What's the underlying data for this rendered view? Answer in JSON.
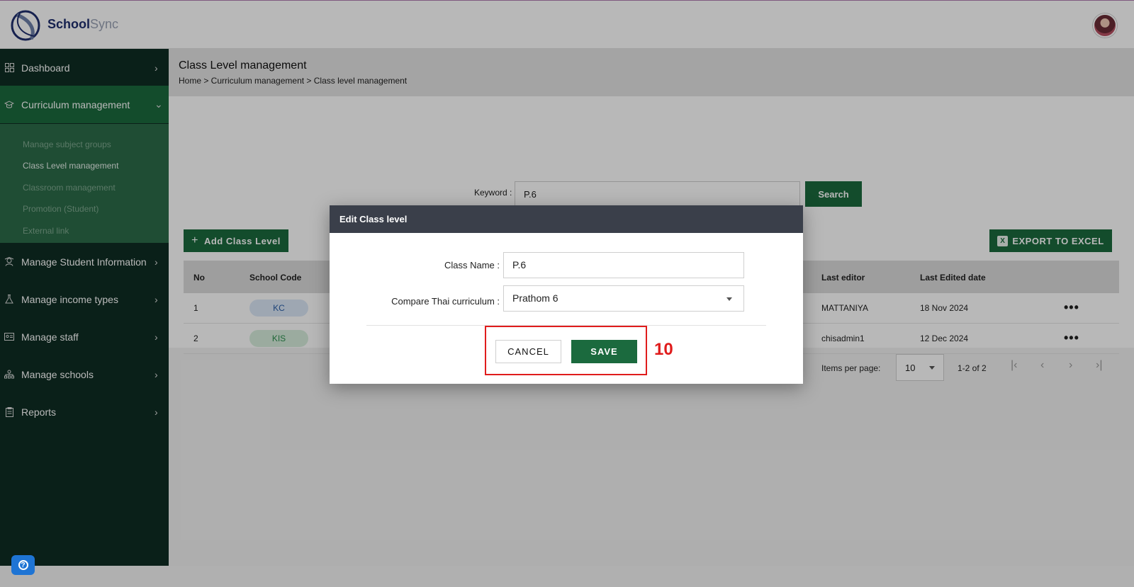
{
  "app": {
    "brand_primary": "School",
    "brand_secondary": "Sync",
    "accent_color": "#1b6a3e",
    "sidebar_color": "#0e2d23"
  },
  "sidebar": {
    "items": [
      {
        "label": "Dashboard",
        "icon": "grid-icon"
      },
      {
        "label": "Curriculum management",
        "icon": "graduation-cap-icon"
      },
      {
        "label": "Manage Student Information",
        "icon": "student-icon"
      },
      {
        "label": "Manage income types",
        "icon": "flask-icon"
      },
      {
        "label": "Manage staff",
        "icon": "id-card-icon"
      },
      {
        "label": "Manage schools",
        "icon": "hierarchy-icon"
      },
      {
        "label": "Reports",
        "icon": "clipboard-icon"
      }
    ],
    "submenu": [
      "Manage subject groups",
      "Class Level management",
      "Classroom management",
      "Promotion (Student)",
      "External link"
    ]
  },
  "page": {
    "title": "Class Level management",
    "breadcrumb": "Home > Curriculum management > Class level management"
  },
  "search": {
    "label": "Keyword :",
    "value": "P.6",
    "button": "Search"
  },
  "actions": {
    "add": "Add Class Level",
    "export": "EXPORT TO EXCEL"
  },
  "table": {
    "headers": [
      "No",
      "School Code",
      "Last editor",
      "Last Edited date"
    ],
    "rows": [
      {
        "no": "1",
        "school_code": "KC",
        "last_editor": "MATTANIYA",
        "date": "18 Nov 2024"
      },
      {
        "no": "2",
        "school_code": "KIS",
        "last_editor": "chisadmin1",
        "date": "12 Dec 2024"
      }
    ]
  },
  "pagination": {
    "label": "Items per page:",
    "per_page": "10",
    "range": "1-2 of 2"
  },
  "dialog": {
    "title": "Edit Class level",
    "class_name_label": "Class Name :",
    "class_name_value": "P.6",
    "compare_label": "Compare Thai curriculum :",
    "compare_value": "Prathom 6",
    "cancel": "CANCEL",
    "save": "SAVE"
  },
  "annotation": {
    "step": "10",
    "color": "#e01c1c"
  }
}
